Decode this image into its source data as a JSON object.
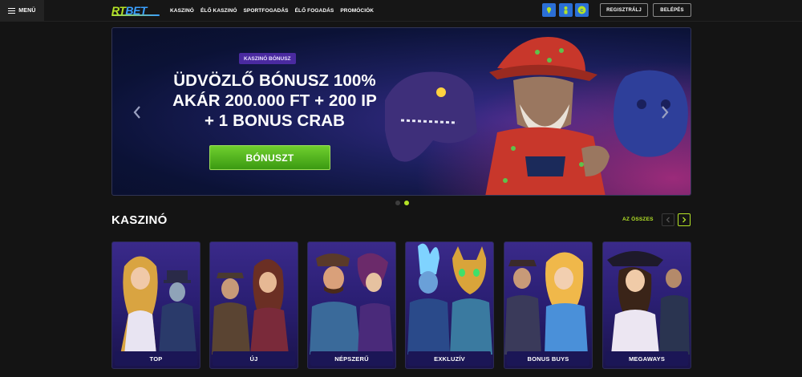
{
  "header": {
    "menu_label": "MENÜ",
    "logo": {
      "part1": "RT",
      "part2": "BET"
    },
    "nav": [
      "KASZINÓ",
      "ÉLŐ KASZINÓ",
      "SPORTFOGADÁS",
      "ÉLŐ FOGADÁS",
      "PROMÓCIÓK"
    ],
    "icons": [
      "map-pin-icon",
      "person-icon",
      "cash-promo-icon"
    ],
    "register_label": "REGISZTRÁLJ",
    "login_label": "BELÉPÉS"
  },
  "hero": {
    "tag": "KASZINÓ BÓNUSZ",
    "title_line1": "ÜDVÖZLŐ BÓNUSZ 100%",
    "title_line2": "AKÁR 200.000 FT + 200 IP",
    "title_line3": "+ 1 BONUS CRAB",
    "cta_label": "BÓNUSZT",
    "slides_count": 2,
    "active_slide": 2
  },
  "casino": {
    "title": "KASZINÓ",
    "see_all_label": "AZ ÖSSZES",
    "categories": [
      "TOP",
      "ÚJ",
      "NÉPSZERŰ",
      "EXKLUZÍV",
      "BONUS BUYS",
      "MEGAWAYS"
    ]
  },
  "colors": {
    "accent": "#b4e327",
    "brand_blue": "#3aa0ff",
    "cta_green": "#4fae1c",
    "card_purple": "#2b1f74"
  }
}
